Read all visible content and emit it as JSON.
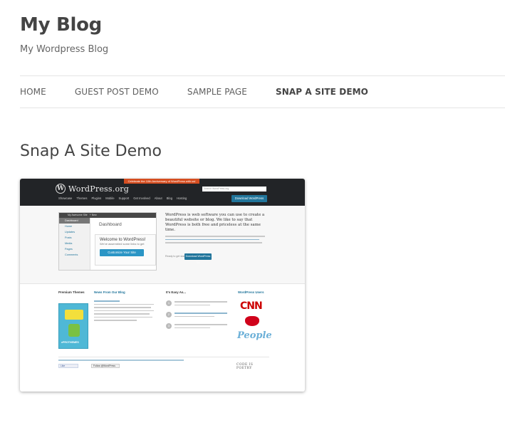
{
  "site": {
    "title": "My Blog",
    "description": "My Wordpress Blog"
  },
  "nav": {
    "items": [
      {
        "label": "HOME",
        "current": false
      },
      {
        "label": "GUEST POST DEMO",
        "current": false
      },
      {
        "label": "SAMPLE PAGE",
        "current": false
      },
      {
        "label": "SNAP A SITE DEMO",
        "current": true
      }
    ]
  },
  "post": {
    "title": "Snap A Site Demo"
  },
  "snapshot": {
    "ribbon": "Celebrate the 10th Anniversary of WordPress with us!",
    "logo_text": "WordPress.org",
    "search_placeholder": "Search WordPress.org",
    "nav": [
      "Showcase",
      "Themes",
      "Plugins",
      "Mobile",
      "Support",
      "Get Involved",
      "About",
      "Blog",
      "Hosting"
    ],
    "download_button": "Download WordPress",
    "dashboard_site": "My Awesome Site",
    "dashboard_new": "+ New",
    "dashboard_heading": "Dashboard",
    "sidebar": [
      "Dashboard",
      "Home",
      "Updates",
      "Posts",
      "Media",
      "Pages",
      "Comments"
    ],
    "welcome_heading": "Welcome to WordPress!",
    "welcome_sub": "We've assembled some links to get",
    "customize_button": "Customize Your Site",
    "intro": "WordPress is web software you can use to create a beautiful website or blog. We like to say that WordPress is both free and priceless at the same time.",
    "ready_text": "Ready to get started?",
    "download_button_2": "Download WordPress 3.x",
    "col_premium": "Premium Themes",
    "col_news": "News From Our Blog",
    "col_easy": "It's Easy As...",
    "col_users": "WordPress Users",
    "theme_label": "ePROTHEMES",
    "like_label": "Like",
    "follow_label": "Follow @WordPress",
    "poetry": "CODE IS POETRY",
    "brand_cnn": "CNN",
    "brand_people": "People",
    "colors": {
      "wp_dark": "#222427",
      "wp_blue": "#21759b",
      "ribbon": "#d54e21"
    }
  }
}
